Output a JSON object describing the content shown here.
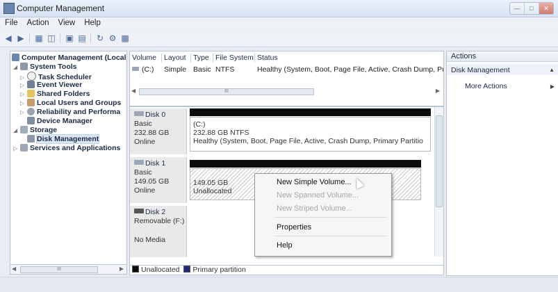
{
  "window": {
    "title": "Computer Management"
  },
  "menu": [
    "File",
    "Action",
    "View",
    "Help"
  ],
  "toolbar": {
    "icons": [
      "back-arrow-icon",
      "forward-arrow-icon",
      "up-folder-icon",
      "show-hide-tree-icon",
      "help-icon",
      "disk-icon",
      "refresh-icon",
      "properties-icon",
      "console-icon"
    ]
  },
  "tree": {
    "root": "Computer Management (Local)",
    "system_tools": "System Tools",
    "task_scheduler": "Task Scheduler",
    "event_viewer": "Event Viewer",
    "shared_folders": "Shared Folders",
    "local_users": "Local Users and Groups",
    "reliability": "Reliability and Performa",
    "device_manager": "Device Manager",
    "storage": "Storage",
    "disk_management": "Disk Management",
    "services": "Services and Applications"
  },
  "volume_list": {
    "headers": [
      "Volume",
      "Layout",
      "Type",
      "File System",
      "Status"
    ],
    "rows": [
      {
        "volume": "(C:)",
        "layout": "Simple",
        "type": "Basic",
        "fs": "NTFS",
        "status": "Healthy (System, Boot, Page File, Active, Crash Dump, Prir"
      }
    ],
    "hscroll_label": "III"
  },
  "disks": [
    {
      "name": "Disk 0",
      "type": "Basic",
      "size": "232.88 GB",
      "state": "Online",
      "part_name": "(C:)",
      "part_size": "232.88 GB NTFS",
      "part_status": "Healthy (System, Boot, Page File, Active, Crash Dump, Primary Partitio"
    },
    {
      "name": "Disk 1",
      "type": "Basic",
      "size": "149.05 GB",
      "state": "Online",
      "part_size": "149.05 GB",
      "part_status": "Unallocated"
    },
    {
      "name": "Disk 2",
      "type": "Removable (F:)",
      "state": "No Media"
    }
  ],
  "legend": {
    "unallocated": "Unallocated",
    "primary": "Primary partition"
  },
  "context_menu": {
    "new_simple": "New Simple Volume...",
    "new_spanned": "New Spanned Volume...",
    "new_striped": "New Striped Volume...",
    "properties": "Properties",
    "help": "Help"
  },
  "actions": {
    "header": "Actions",
    "section": "Disk Management",
    "more": "More Actions"
  },
  "tree_scroll_label": "III",
  "colors": {
    "unallocated": "#0c0c0c",
    "primary": "#1b2a7a"
  }
}
